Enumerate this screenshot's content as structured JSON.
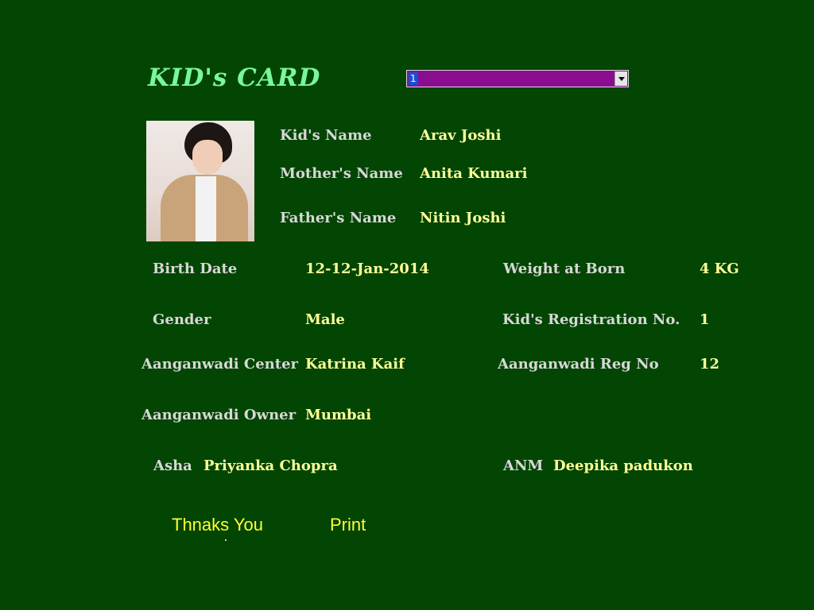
{
  "window": {
    "title": "KID's CARD"
  },
  "selector": {
    "selected": "1"
  },
  "photo": {
    "icon": "kid-photo"
  },
  "fields": {
    "kid_name_label": "Kid's Name",
    "kid_name": "Arav Joshi",
    "mother_name_label": "Mother's Name",
    "mother_name": "Anita Kumari",
    "father_name_label": "Father's Name",
    "father_name": "Nitin Joshi",
    "birth_date_label": "Birth Date",
    "birth_date": "12-12-Jan-2014",
    "weight_label": "Weight at Born",
    "weight": "4 KG",
    "gender_label": "Gender",
    "gender": "Male",
    "reg_no_label": "Kid's Registration No.",
    "reg_no": "1",
    "center_label": "Aanganwadi Center",
    "center": "Katrina Kaif",
    "center_reg_label": "Aanganwadi Reg No",
    "center_reg": "12",
    "owner_label": "Aanganwadi Owner",
    "owner": "Mumbai",
    "asha_label": "Asha",
    "asha": "Priyanka Chopra",
    "anm_label": "ANM",
    "anm": "Deepika padukon"
  },
  "actions": {
    "thanks_label": "Thnaks You",
    "print_label": "Print"
  },
  "colors": {
    "background": "#034502",
    "title": "#79f79a",
    "label": "#d7d7d7",
    "value": "#ffff99",
    "button_text": "#ffff33",
    "dropdown_bg": "#8a0d8f"
  }
}
